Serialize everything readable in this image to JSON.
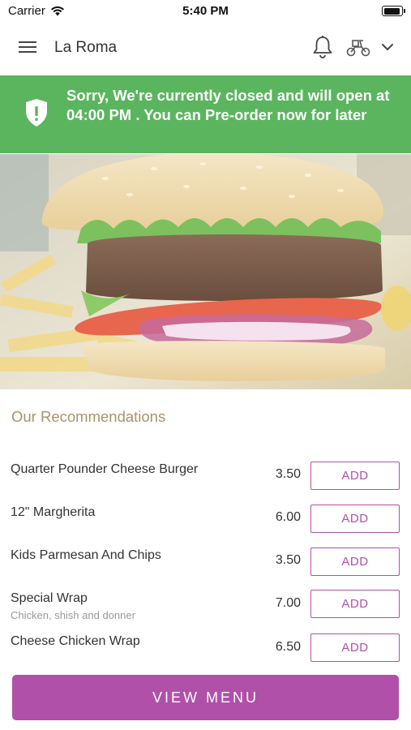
{
  "status_bar": {
    "carrier": "Carrier",
    "time": "5:40 PM"
  },
  "header": {
    "title": "La Roma",
    "icons": [
      "menu-icon",
      "bell-icon",
      "scooter-icon",
      "chevron-down-icon"
    ]
  },
  "banner": {
    "message": "Sorry, We're currently closed and will open at 04:00 PM . You can Pre-order now for later",
    "icon": "shield-exclamation-icon",
    "color": "#5bb55f"
  },
  "recommendations": {
    "heading": "Our Recommendations",
    "items": [
      {
        "name": "Quarter Pounder Cheese Burger",
        "description": "",
        "price": "3.50",
        "add_label": "ADD"
      },
      {
        "name": "12\" Margherita",
        "description": "",
        "price": "6.00",
        "add_label": "ADD"
      },
      {
        "name": "Kids Parmesan And Chips",
        "description": "",
        "price": "3.50",
        "add_label": "ADD"
      },
      {
        "name": "Special Wrap",
        "description": "Chicken, shish and donner",
        "price": "7.00",
        "add_label": "ADD"
      },
      {
        "name": "Cheese Chicken Wrap",
        "description": "",
        "price": "6.50",
        "add_label": "ADD"
      }
    ]
  },
  "footer": {
    "view_menu_label": "VIEW MENU"
  },
  "colors": {
    "accent": "#b050a8",
    "banner": "#5bb55f",
    "heading": "#a8946a"
  }
}
